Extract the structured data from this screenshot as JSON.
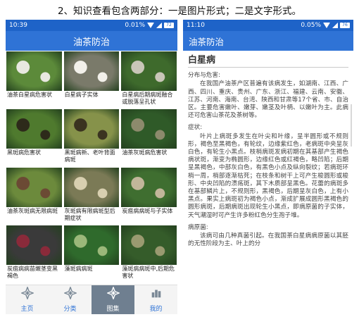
{
  "caption": "2、知识查看包含两部分：一是图片形式；二是文字形式。",
  "left": {
    "status": {
      "time": "10:39",
      "right": "0.01% ",
      "battery": "72"
    },
    "title": "油茶防治",
    "items": [
      {
        "label": "油茶白星病危害状",
        "bg": "#5c8a3a",
        "spot": "#e8e8e0"
      },
      {
        "label": "白星病子实体",
        "bg": "#7a7a6a",
        "spot": "#f2f0ea"
      },
      {
        "label": "白星病后期病斑融合或脱落呈孔状",
        "bg": "#3e6a2c",
        "spot": "#c9c6b8"
      },
      {
        "label": "黑斑病危害状",
        "bg": "#4f7a2e",
        "spot": "#2d2a1a"
      },
      {
        "label": "黑斑病新、老叶背面病斑",
        "bg": "#86924a",
        "spot": "#3a3320"
      },
      {
        "label": "油茶灰斑病危害状",
        "bg": "#2f5a28",
        "spot": "#8c8a6c"
      },
      {
        "label": "油茶灰斑病无限病斑",
        "bg": "#6c8a3c",
        "spot": "#6b4a34"
      },
      {
        "label": "灰斑病有限病斑型后期症状",
        "bg": "#7b7a56",
        "spot": "#d8cfb0"
      },
      {
        "label": "炭疽病病斑与子实体",
        "bg": "#3f6e30",
        "spot": "#c2b69a"
      },
      {
        "label": "炭疽病病苗嫩茎变黑褐色",
        "bg": "#3a3a3a",
        "spot": "#8a2a3a"
      },
      {
        "label": "藻斑病病斑",
        "bg": "#2f6a2c",
        "spot": "#9bb87a"
      },
      {
        "label": "藻斑病病斑中,后期危害状",
        "bg": "#355c2a",
        "spot": "#9a9a70"
      }
    ],
    "tabs": [
      {
        "label": "主页",
        "icon": "home-star-icon"
      },
      {
        "label": "分类",
        "icon": "category-star-icon"
      },
      {
        "label": "图集",
        "icon": "gallery-star-icon",
        "active": true
      },
      {
        "label": "我的",
        "icon": "profile-icon"
      }
    ]
  },
  "right": {
    "status": {
      "time": "11:10",
      "right": "0.05% ",
      "battery": "76"
    },
    "title": "油茶防治",
    "heading": "白星病",
    "sections": [
      {
        "title": "分布与危害:",
        "body": "在我国产油茶产区普遍有该病发生，如湖南、江西、广西、四川、重庆、贵州、广东、浙江、福建、云南、安徽、江苏、河南、海南、台湾、陕西和甘肃等17个省、市、自治区。主要危害嫩叶、嫩芽、嫩茎及叶柄、以嫩叶为主。此病还可危害山茶花及茶树等。"
      },
      {
        "title": "症状:",
        "body": "叶片上病斑多发生在叶尖和叶缘，呈半圆形或不规则形，褐色至黑褐色，有轮纹，边缘紫红色，老病斑中央呈灰白色，有轮生小黑点。枝梢病斑发病初期在其基部产生褐色病状斑，渐变为椭圆形，边缘红色或红褐色，略凹陷；后期呈黑褐色，中部灰白色，有黑色小点及纵向裂纹；若病斑环梢一周，梢部逐渐枯死；在枝条和树干上可产生梭圆形或梭形、中央凹陷的溃疡斑，其下木质部呈黑色。花蕾的病斑多在基部鳞片上，不规则形，黑褐色，后期呈灰白色，上有小黑点。果实上病斑初为褐色小点，渐成扩展成圆形黑褐色的圆形病斑，后期病斑出现轮生小黑点，即病原菌的子实体，天气潮湿时可产生许多粉红色分生孢子堆。"
      },
      {
        "title": "病原菌:",
        "body": "该病可由几种真菌引起。在我国茶白星病病原菌以其胚的无性阶段为主、叶上的分"
      }
    ]
  }
}
